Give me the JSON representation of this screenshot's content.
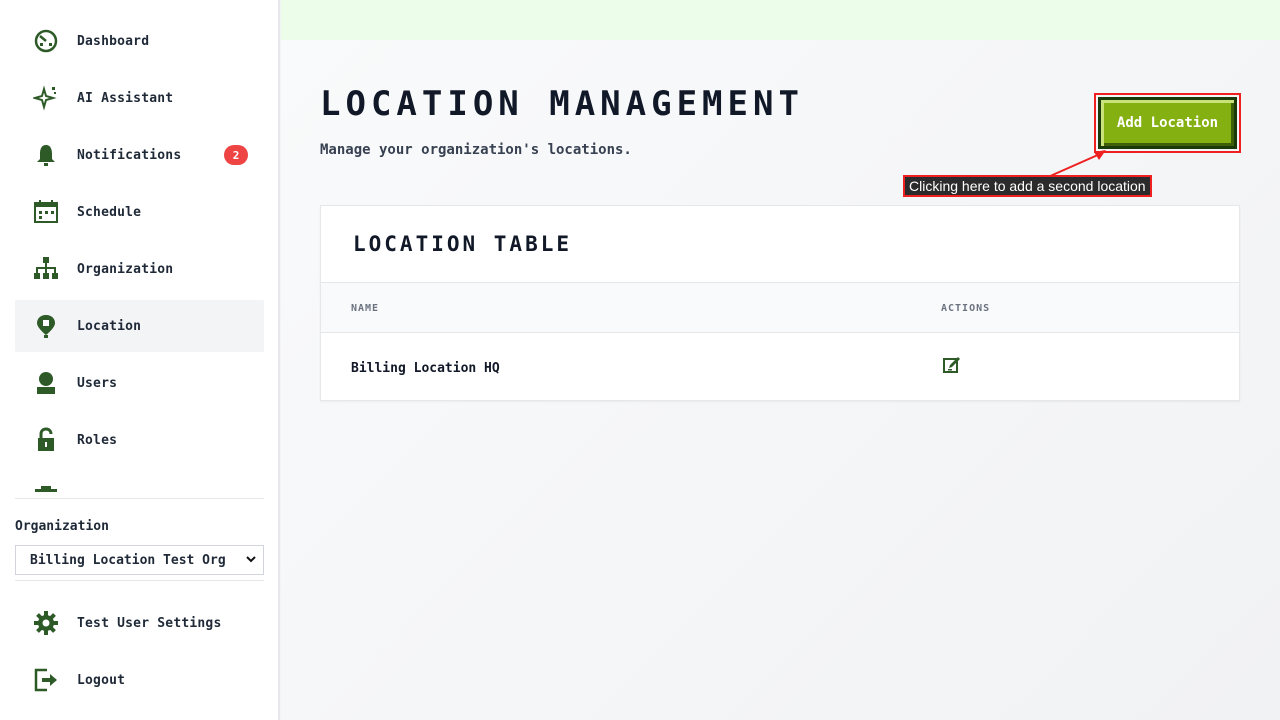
{
  "sidebar": {
    "items": [
      {
        "label": "Dashboard",
        "icon": "dashboard-icon"
      },
      {
        "label": "AI Assistant",
        "icon": "sparkle-icon"
      },
      {
        "label": "Notifications",
        "icon": "bell-icon",
        "badge": "2"
      },
      {
        "label": "Schedule",
        "icon": "calendar-icon"
      },
      {
        "label": "Organization",
        "icon": "org-chart-icon"
      },
      {
        "label": "Location",
        "icon": "location-pin-icon",
        "active": true
      },
      {
        "label": "Users",
        "icon": "user-icon"
      },
      {
        "label": "Roles",
        "icon": "lock-icon"
      }
    ],
    "org_label": "Organization",
    "org_selected": "Billing Location Test Org",
    "bottom_items": [
      {
        "label": "Test User Settings",
        "icon": "gear-icon"
      },
      {
        "label": "Logout",
        "icon": "logout-icon"
      }
    ]
  },
  "page": {
    "title": "LOCATION MANAGEMENT",
    "subtitle": "Manage your organization's locations.",
    "add_button": "Add Location",
    "callout": "Clicking here to add a second location"
  },
  "table": {
    "title": "LOCATION TABLE",
    "columns": [
      "NAME",
      "ACTIONS"
    ],
    "rows": [
      {
        "name": "Billing Location HQ"
      }
    ]
  },
  "colors": {
    "accent_green": "#84b011",
    "icon_green": "#2d5a27",
    "badge_red": "#ef4444",
    "annotation_red": "#ef2020"
  }
}
